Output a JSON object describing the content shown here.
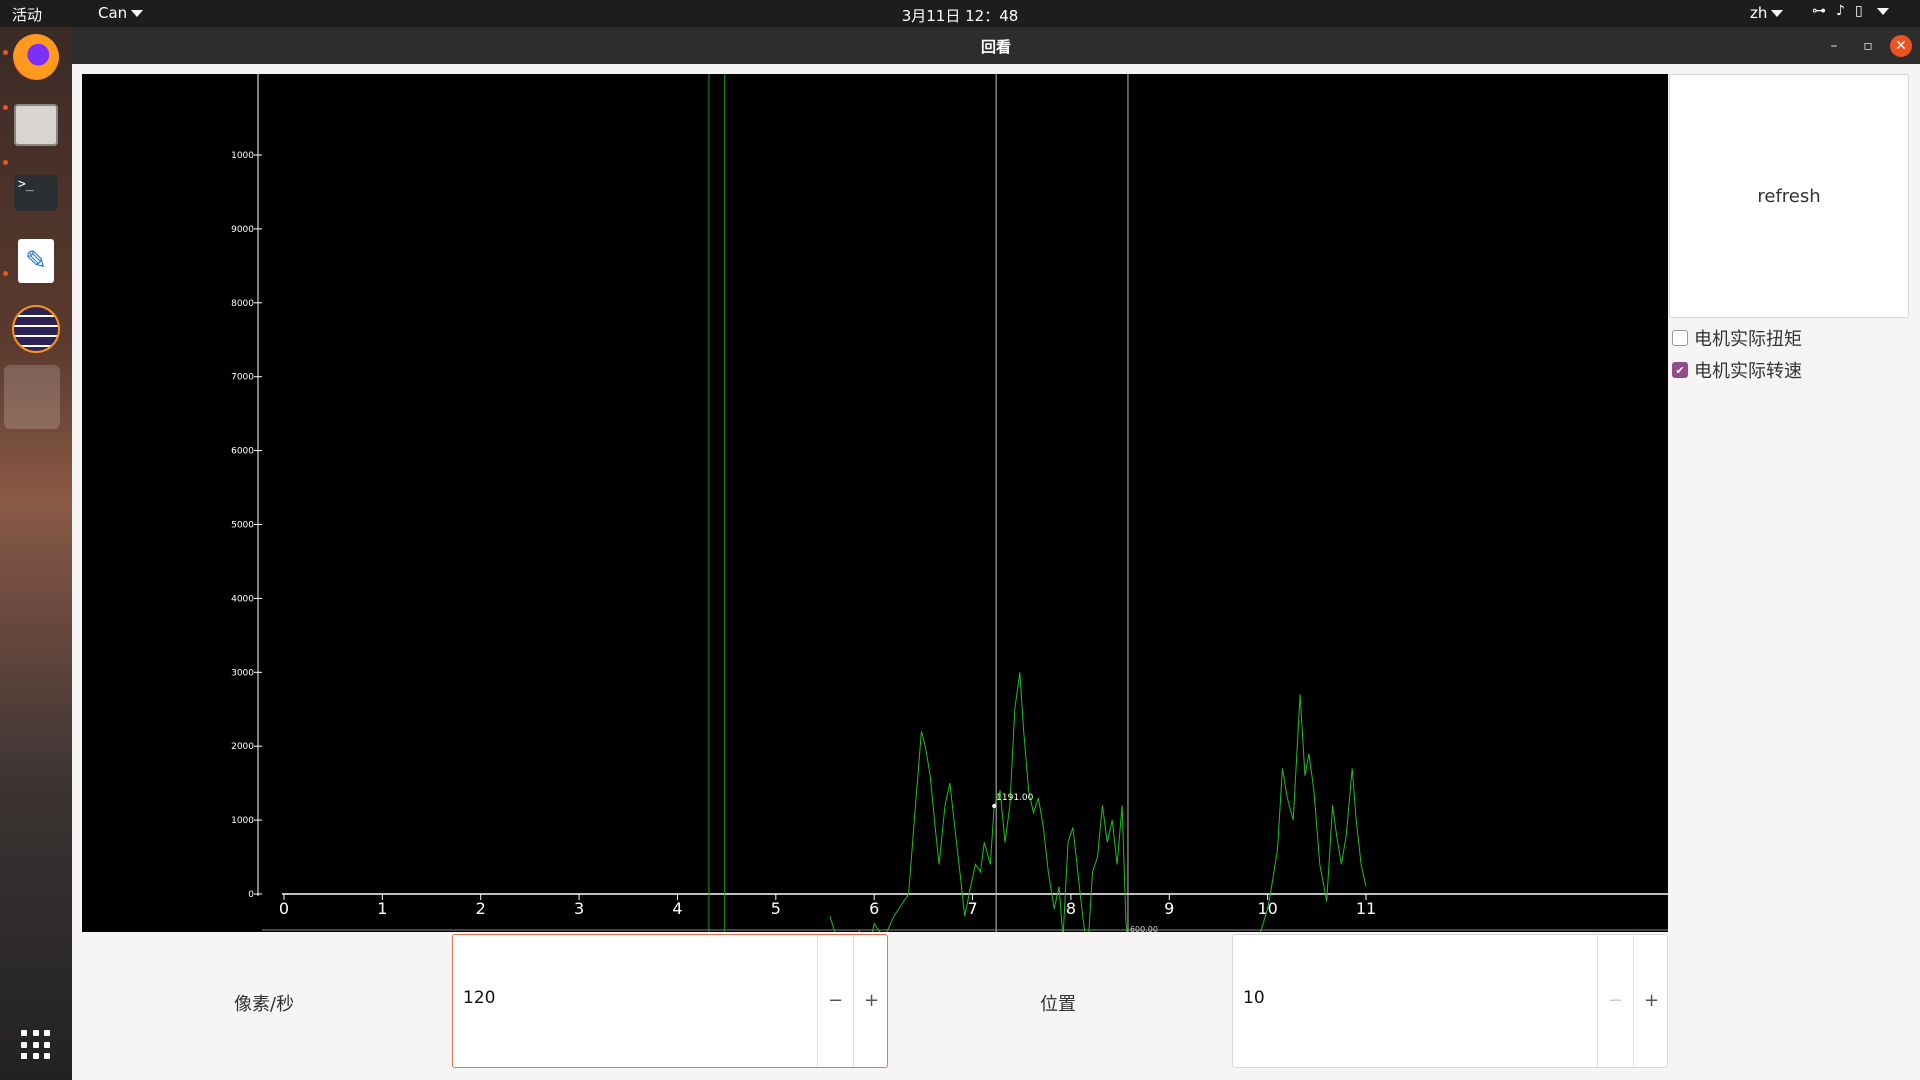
{
  "topbar": {
    "activities": "活动",
    "app_menu": "Can",
    "clock": "3月11日  12：48",
    "lang": "zh"
  },
  "window": {
    "title": "回看"
  },
  "toolbar": {
    "refresh_label": "refresh",
    "checkbox_torque": {
      "label": "电机实际扭矩",
      "checked": false
    },
    "checkbox_speed": {
      "label": "电机实际转速",
      "checked": true
    }
  },
  "controls": {
    "rate_label": "像素/秒",
    "rate_value": "120",
    "position_label": "位置",
    "position_value": "10",
    "minus": "−",
    "plus": "+"
  },
  "chart_data": {
    "type": "line",
    "y_ticks": [
      "0",
      "1000",
      "2000",
      "3000",
      "4000",
      "5000",
      "6000",
      "7000",
      "8000",
      "9000",
      "1000"
    ],
    "x_ticks": [
      "0",
      "1",
      "2",
      "3",
      "4",
      "5",
      "6",
      "7",
      "8",
      "9",
      "10",
      "11"
    ],
    "xlim": [
      0,
      11
    ],
    "ylim": [
      0,
      10000
    ],
    "cursor_label": "1191.00",
    "cursor_point": {
      "x": 7.22,
      "y": 1191
    },
    "bottom_partial_label": "600.00",
    "marker_lines_x": [
      4.32,
      4.48,
      7.24,
      8.58
    ],
    "series": [
      {
        "color": "#1fbf1f",
        "points": [
          [
            5.55,
            -300
          ],
          [
            5.62,
            -600
          ],
          [
            5.68,
            -1200
          ],
          [
            5.85,
            -500
          ],
          [
            5.92,
            -900
          ],
          [
            6.0,
            -400
          ],
          [
            6.1,
            -600
          ],
          [
            6.2,
            -300
          ],
          [
            6.35,
            0
          ],
          [
            6.42,
            1200
          ],
          [
            6.48,
            2200
          ],
          [
            6.52,
            2000
          ],
          [
            6.57,
            1600
          ],
          [
            6.62,
            900
          ],
          [
            6.66,
            400
          ],
          [
            6.72,
            1200
          ],
          [
            6.77,
            1500
          ],
          [
            6.82,
            900
          ],
          [
            6.88,
            200
          ],
          [
            6.92,
            -300
          ],
          [
            6.98,
            100
          ],
          [
            7.03,
            400
          ],
          [
            7.08,
            300
          ],
          [
            7.12,
            700
          ],
          [
            7.18,
            400
          ],
          [
            7.22,
            1191
          ],
          [
            7.28,
            1400
          ],
          [
            7.33,
            700
          ],
          [
            7.38,
            1200
          ],
          [
            7.43,
            2500
          ],
          [
            7.48,
            3000
          ],
          [
            7.52,
            2200
          ],
          [
            7.57,
            1400
          ],
          [
            7.62,
            1100
          ],
          [
            7.67,
            1300
          ],
          [
            7.72,
            900
          ],
          [
            7.77,
            300
          ],
          [
            7.83,
            -200
          ],
          [
            7.88,
            100
          ],
          [
            7.92,
            -600
          ],
          [
            7.97,
            700
          ],
          [
            8.02,
            900
          ],
          [
            8.07,
            300
          ],
          [
            8.12,
            -300
          ],
          [
            8.17,
            -800
          ],
          [
            8.22,
            300
          ],
          [
            8.27,
            500
          ],
          [
            8.32,
            1200
          ],
          [
            8.37,
            700
          ],
          [
            8.42,
            1000
          ],
          [
            8.47,
            400
          ],
          [
            8.52,
            1200
          ],
          [
            8.56,
            -400
          ],
          [
            8.6,
            -900
          ],
          [
            8.7,
            -700
          ],
          [
            8.8,
            -1200
          ],
          [
            8.9,
            -600
          ],
          [
            9.0,
            -1000
          ],
          [
            9.2,
            -700
          ],
          [
            9.4,
            -1100
          ],
          [
            9.6,
            -800
          ],
          [
            9.8,
            -1200
          ],
          [
            9.93,
            -500
          ],
          [
            10.0,
            -200
          ],
          [
            10.04,
            100
          ],
          [
            10.1,
            600
          ],
          [
            10.15,
            1700
          ],
          [
            10.2,
            1300
          ],
          [
            10.26,
            1000
          ],
          [
            10.33,
            2700
          ],
          [
            10.38,
            1600
          ],
          [
            10.42,
            1900
          ],
          [
            10.47,
            1400
          ],
          [
            10.53,
            400
          ],
          [
            10.6,
            -100
          ],
          [
            10.66,
            1200
          ],
          [
            10.7,
            800
          ],
          [
            10.75,
            400
          ],
          [
            10.8,
            800
          ],
          [
            10.86,
            1700
          ],
          [
            10.9,
            1000
          ],
          [
            10.95,
            400
          ],
          [
            11.0,
            100
          ]
        ]
      }
    ]
  }
}
